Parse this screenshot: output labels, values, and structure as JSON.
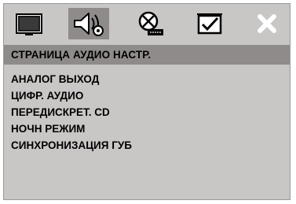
{
  "toolbar": {
    "icons": [
      {
        "name": "general-setup-icon",
        "selected": false
      },
      {
        "name": "audio-setup-icon",
        "selected": true
      },
      {
        "name": "dolby-setup-icon",
        "selected": false
      },
      {
        "name": "preference-setup-icon",
        "selected": false
      },
      {
        "name": "exit-icon",
        "selected": false
      }
    ]
  },
  "page": {
    "title": "СТРАНИЦА АУДИО НАСТР."
  },
  "menu": {
    "items": [
      {
        "label": "АНАЛОГ ВЫХОД"
      },
      {
        "label": "ЦИФР. АУДИО"
      },
      {
        "label": "ПЕРЕДИСКРЕТ. CD"
      },
      {
        "label": "НОЧН РЕЖИМ"
      },
      {
        "label": "СИНХРОНИЗАЦИЯ ГУБ"
      }
    ]
  },
  "colors": {
    "panel": "#c9c6c6",
    "highlight": "#8f8b8b",
    "text": "#000000"
  }
}
